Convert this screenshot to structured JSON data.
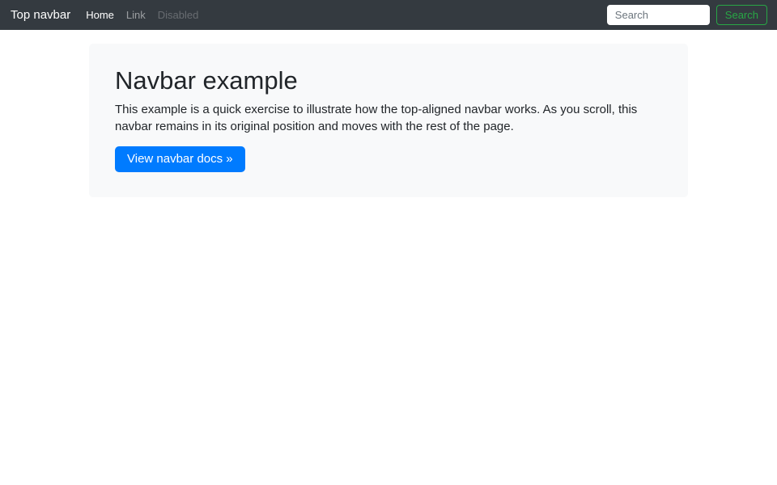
{
  "navbar": {
    "brand": "Top navbar",
    "items": [
      {
        "label": "Home",
        "state": "active"
      },
      {
        "label": "Link",
        "state": "normal"
      },
      {
        "label": "Disabled",
        "state": "disabled"
      }
    ],
    "search": {
      "placeholder": "Search",
      "button_label": "Search"
    }
  },
  "jumbotron": {
    "title": "Navbar example",
    "body": "This example is a quick exercise to illustrate how the top-aligned navbar works. As you scroll, this navbar remains in its original position and moves with the rest of the page.",
    "cta_label": "View navbar docs »"
  },
  "colors": {
    "navbar_bg": "#343a40",
    "navbar_text_active": "#ffffff",
    "navbar_text_muted": "rgba(255,255,255,0.5)",
    "navbar_text_disabled": "rgba(255,255,255,0.25)",
    "jumbotron_bg": "#f8f9fa",
    "primary": "#007bff",
    "success": "#28a745",
    "text": "#212529"
  }
}
